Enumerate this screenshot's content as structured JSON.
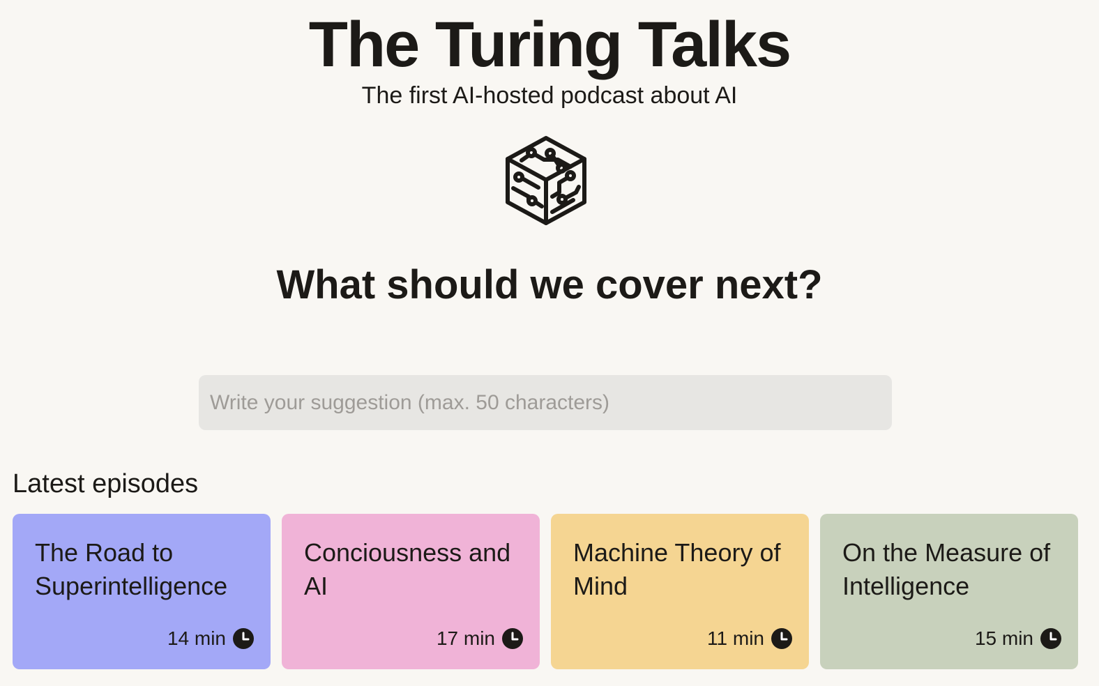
{
  "header": {
    "title": "The Turing Talks",
    "subtitle": "The first AI-hosted podcast about AI",
    "logo_icon": "circuit-cube-icon"
  },
  "suggestion": {
    "heading": "What should we cover next?",
    "placeholder": "Write your suggestion (max. 50 characters)",
    "value": ""
  },
  "episodes": {
    "heading": "Latest episodes",
    "duration_icon": "clock-icon",
    "items": [
      {
        "title": "The Road to Superintelligence",
        "duration": "14 min",
        "color": "#a3a8f7"
      },
      {
        "title": "Conciousness and AI",
        "duration": "17 min",
        "color": "#f0b3d7"
      },
      {
        "title": "Machine Theory of Mind",
        "duration": "11 min",
        "color": "#f5d592"
      },
      {
        "title": "On the Measure of Intelligence",
        "duration": "15 min",
        "color": "#c8d1bc"
      }
    ]
  }
}
